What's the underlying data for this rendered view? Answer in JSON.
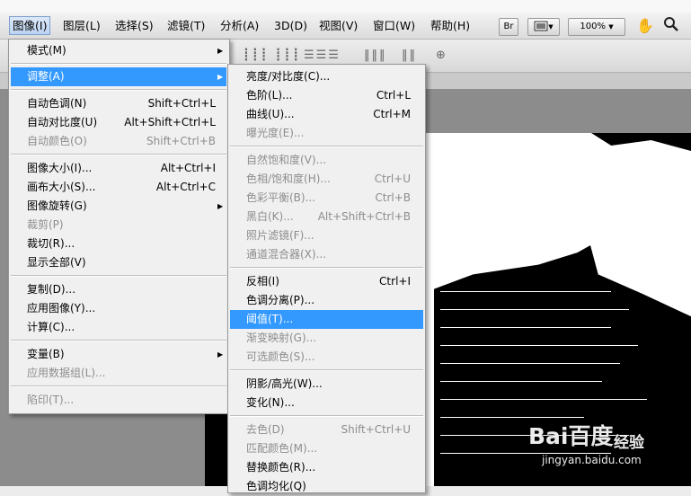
{
  "menubar": {
    "items": [
      "图像(I)",
      "图层(L)",
      "选择(S)",
      "滤镜(T)",
      "分析(A)",
      "3D(D)",
      "视图(V)",
      "窗口(W)",
      "帮助(H)"
    ],
    "br_label": "Br",
    "zoom": "100%"
  },
  "image_menu": {
    "items": [
      {
        "label": "模式(M)",
        "shortcut": "",
        "submenu": true,
        "disabled": false
      },
      {
        "label": "调整(A)",
        "shortcut": "",
        "submenu": true,
        "disabled": false,
        "highlight": true
      },
      {
        "label": "自动色调(N)",
        "shortcut": "Shift+Ctrl+L",
        "disabled": false
      },
      {
        "label": "自动对比度(U)",
        "shortcut": "Alt+Shift+Ctrl+L",
        "disabled": false
      },
      {
        "label": "自动颜色(O)",
        "shortcut": "Shift+Ctrl+B",
        "disabled": true
      },
      {
        "label": "图像大小(I)...",
        "shortcut": "Alt+Ctrl+I",
        "disabled": false
      },
      {
        "label": "画布大小(S)...",
        "shortcut": "Alt+Ctrl+C",
        "disabled": false
      },
      {
        "label": "图像旋转(G)",
        "shortcut": "",
        "submenu": true,
        "disabled": false
      },
      {
        "label": "裁剪(P)",
        "shortcut": "",
        "disabled": true
      },
      {
        "label": "裁切(R)...",
        "shortcut": "",
        "disabled": false
      },
      {
        "label": "显示全部(V)",
        "shortcut": "",
        "disabled": false
      },
      {
        "label": "复制(D)...",
        "shortcut": "",
        "disabled": false
      },
      {
        "label": "应用图像(Y)...",
        "shortcut": "",
        "disabled": false
      },
      {
        "label": "计算(C)...",
        "shortcut": "",
        "disabled": false
      },
      {
        "label": "变量(B)",
        "shortcut": "",
        "submenu": true,
        "disabled": false
      },
      {
        "label": "应用数据组(L)...",
        "shortcut": "",
        "disabled": true
      },
      {
        "label": "陷印(T)...",
        "shortcut": "",
        "disabled": true
      }
    ]
  },
  "adjust_menu": {
    "items": [
      {
        "label": "亮度/对比度(C)...",
        "shortcut": "",
        "disabled": false
      },
      {
        "label": "色阶(L)...",
        "shortcut": "Ctrl+L",
        "disabled": false
      },
      {
        "label": "曲线(U)...",
        "shortcut": "Ctrl+M",
        "disabled": false
      },
      {
        "label": "曝光度(E)...",
        "shortcut": "",
        "disabled": true
      },
      {
        "label": "自然饱和度(V)...",
        "shortcut": "",
        "disabled": true
      },
      {
        "label": "色相/饱和度(H)...",
        "shortcut": "Ctrl+U",
        "disabled": true
      },
      {
        "label": "色彩平衡(B)...",
        "shortcut": "Ctrl+B",
        "disabled": true
      },
      {
        "label": "黑白(K)...",
        "shortcut": "Alt+Shift+Ctrl+B",
        "disabled": true
      },
      {
        "label": "照片滤镜(F)...",
        "shortcut": "",
        "disabled": true
      },
      {
        "label": "通道混合器(X)...",
        "shortcut": "",
        "disabled": true
      },
      {
        "label": "反相(I)",
        "shortcut": "Ctrl+I",
        "disabled": false
      },
      {
        "label": "色调分离(P)...",
        "shortcut": "",
        "disabled": false
      },
      {
        "label": "阈值(T)...",
        "shortcut": "",
        "disabled": false,
        "highlight": true
      },
      {
        "label": "渐变映射(G)...",
        "shortcut": "",
        "disabled": true
      },
      {
        "label": "可选颜色(S)...",
        "shortcut": "",
        "disabled": true
      },
      {
        "label": "阴影/高光(W)...",
        "shortcut": "",
        "disabled": false
      },
      {
        "label": "变化(N)...",
        "shortcut": "",
        "disabled": false
      },
      {
        "label": "去色(D)",
        "shortcut": "Shift+Ctrl+U",
        "disabled": true
      },
      {
        "label": "匹配颜色(M)...",
        "shortcut": "",
        "disabled": true
      },
      {
        "label": "替换颜色(R)...",
        "shortcut": "",
        "disabled": false
      },
      {
        "label": "色调均化(Q)",
        "shortcut": "",
        "disabled": false
      }
    ]
  },
  "watermark": {
    "logo": "Bai百度",
    "brand": "经验",
    "url": "jingyan.baidu.com"
  },
  "colors": {
    "highlight": "#3399ff",
    "menu_bg": "#f0f0f0",
    "disabled": "#8d8d8d"
  }
}
